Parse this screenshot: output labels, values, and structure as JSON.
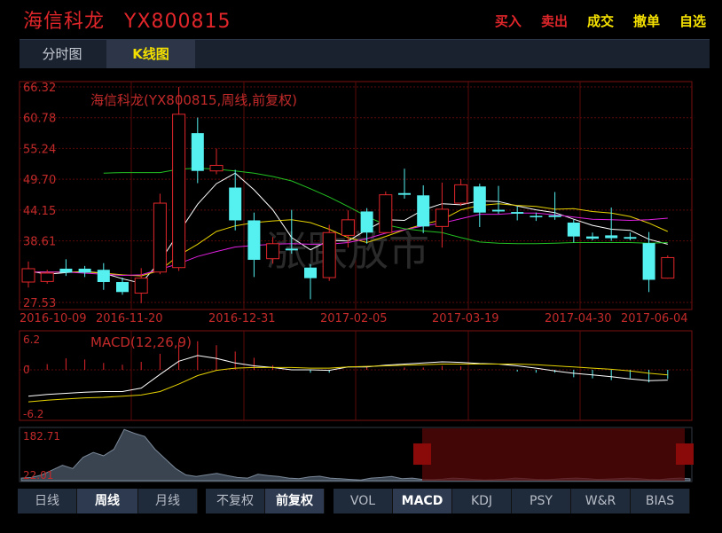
{
  "header": {
    "stock_name": "海信科龙",
    "stock_code": "YX800815",
    "actions": [
      {
        "label": "买入",
        "color": "#e0262a"
      },
      {
        "label": "卖出",
        "color": "#e0262a"
      },
      {
        "label": "成交",
        "color": "#f4e000"
      },
      {
        "label": "撤单",
        "color": "#f4e000"
      },
      {
        "label": "自选",
        "color": "#f4e000"
      }
    ]
  },
  "tabs": [
    {
      "label": "分时图",
      "active": false
    },
    {
      "label": "K线图",
      "active": true
    }
  ],
  "kline": {
    "legend": "海信科龙(YX800815,周线,前复权)",
    "y_ticks": [
      "66.32",
      "60.78",
      "55.24",
      "49.70",
      "44.15",
      "38.61",
      "27.53"
    ],
    "y_values": [
      66.32,
      60.78,
      55.24,
      49.7,
      44.15,
      38.61,
      27.53
    ],
    "x_labels": [
      "2016-10-09",
      "2016-11-20",
      "2016-12-31",
      "2017-02-05",
      "2017-03-19",
      "2017-04-30",
      "2017-06-04"
    ],
    "watermark": "涨跌放市",
    "colors": {
      "up": "#e0262a",
      "down": "#55f0f0",
      "ma1": "#ffffff",
      "ma2": "#e6d200",
      "ma3": "#e020e0",
      "ma4": "#22c022"
    }
  },
  "macd": {
    "legend": "MACD(12,26,9)",
    "y_ticks": [
      "6.2",
      "0",
      "-6.2"
    ]
  },
  "volume": {
    "y_ticks": [
      "182.71",
      "22.01"
    ]
  },
  "bottom_groups": [
    {
      "buttons": [
        {
          "label": "日线",
          "active": false
        },
        {
          "label": "周线",
          "active": true
        },
        {
          "label": "月线",
          "active": false
        }
      ]
    },
    {
      "buttons": [
        {
          "label": "不复权",
          "active": false
        },
        {
          "label": "前复权",
          "active": true
        }
      ]
    },
    {
      "buttons": [
        {
          "label": "VOL",
          "active": false
        },
        {
          "label": "MACD",
          "active": true
        },
        {
          "label": "KDJ",
          "active": false
        },
        {
          "label": "PSY",
          "active": false
        },
        {
          "label": "W&R",
          "active": false
        },
        {
          "label": "BIAS",
          "active": false
        }
      ]
    }
  ],
  "chart_data": {
    "type": "candlestick",
    "title": "海信科龙(YX800815,周线,前复权)",
    "x_ticks": [
      "2016-10-09",
      "2016-11-20",
      "2016-12-31",
      "2017-02-05",
      "2017-03-19",
      "2017-04-30",
      "2017-06-04"
    ],
    "ylim": [
      27.53,
      66.32
    ],
    "candles": [
      {
        "o": 31.2,
        "c": 33.6,
        "h": 34.9,
        "l": 30.2
      },
      {
        "o": 31.3,
        "c": 32.8,
        "h": 33.4,
        "l": 30.9
      },
      {
        "o": 33.6,
        "c": 32.9,
        "h": 35.3,
        "l": 32.3
      },
      {
        "o": 33.6,
        "c": 32.9,
        "h": 34.1,
        "l": 32.1
      },
      {
        "o": 33.4,
        "c": 31.2,
        "h": 34.6,
        "l": 29.8
      },
      {
        "o": 31.2,
        "c": 29.4,
        "h": 32.0,
        "l": 28.9
      },
      {
        "o": 29.2,
        "c": 31.9,
        "h": 33.7,
        "l": 27.4
      },
      {
        "o": 33.0,
        "c": 45.4,
        "h": 47.1,
        "l": 32.6
      },
      {
        "o": 33.8,
        "c": 61.4,
        "h": 66.3,
        "l": 33.2
      },
      {
        "o": 58.0,
        "c": 51.2,
        "h": 60.8,
        "l": 49.0
      },
      {
        "o": 51.2,
        "c": 52.2,
        "h": 55.2,
        "l": 50.6
      },
      {
        "o": 48.2,
        "c": 42.3,
        "h": 51.4,
        "l": 40.5
      },
      {
        "o": 42.3,
        "c": 35.2,
        "h": 43.7,
        "l": 32.1
      },
      {
        "o": 35.4,
        "c": 38.1,
        "h": 39.3,
        "l": 34.5
      },
      {
        "o": 37.2,
        "c": 36.9,
        "h": 44.2,
        "l": 36.3
      },
      {
        "o": 33.8,
        "c": 31.9,
        "h": 34.4,
        "l": 28.1
      },
      {
        "o": 32.0,
        "c": 40.1,
        "h": 41.5,
        "l": 31.4
      },
      {
        "o": 39.6,
        "c": 42.4,
        "h": 44.1,
        "l": 37.4
      },
      {
        "o": 43.9,
        "c": 40.1,
        "h": 44.5,
        "l": 38.1
      },
      {
        "o": 40.1,
        "c": 46.9,
        "h": 47.5,
        "l": 40.0
      },
      {
        "o": 47.2,
        "c": 46.9,
        "h": 51.6,
        "l": 46.2
      },
      {
        "o": 46.8,
        "c": 41.2,
        "h": 48.6,
        "l": 40.0
      },
      {
        "o": 41.2,
        "c": 44.3,
        "h": 49.1,
        "l": 37.4
      },
      {
        "o": 45.4,
        "c": 48.7,
        "h": 49.7,
        "l": 44.9
      },
      {
        "o": 48.4,
        "c": 43.7,
        "h": 48.9,
        "l": 41.1
      },
      {
        "o": 44.2,
        "c": 43.9,
        "h": 48.5,
        "l": 43.5
      },
      {
        "o": 43.8,
        "c": 43.5,
        "h": 44.8,
        "l": 42.3
      },
      {
        "o": 43.1,
        "c": 42.9,
        "h": 43.7,
        "l": 42.2
      },
      {
        "o": 43.2,
        "c": 42.9,
        "h": 47.4,
        "l": 42.4
      },
      {
        "o": 41.9,
        "c": 39.4,
        "h": 42.4,
        "l": 38.3
      },
      {
        "o": 39.4,
        "c": 39.0,
        "h": 40.1,
        "l": 38.7
      },
      {
        "o": 39.6,
        "c": 39.1,
        "h": 44.6,
        "l": 38.6
      },
      {
        "o": 39.3,
        "c": 39.0,
        "h": 40.1,
        "l": 38.7
      },
      {
        "o": 38.2,
        "c": 31.6,
        "h": 40.2,
        "l": 29.4
      },
      {
        "o": 31.9,
        "c": 35.6,
        "h": 36.0,
        "l": 31.8
      }
    ],
    "ma_series": [
      {
        "values": [
          33.2,
          32.6,
          32.9,
          33.1,
          32.8,
          31.8,
          31.0,
          34.9,
          40.1,
          45.2,
          48.9,
          50.8,
          47.8,
          44.2,
          39.2,
          37.0,
          38.7,
          38.6,
          40.6,
          42.4,
          42.3,
          44.2,
          45.3,
          45.1,
          45.8,
          45.7,
          44.9,
          44.2,
          43.7,
          42.5,
          41.4,
          40.7,
          40.5,
          38.9,
          38.0
        ]
      },
      {
        "values": [
          33.0,
          33.0,
          33.0,
          33.0,
          32.8,
          32.5,
          32.3,
          33.3,
          36.0,
          38.0,
          40.3,
          41.3,
          41.9,
          42.2,
          42.4,
          41.9,
          40.7,
          39.2,
          38.3,
          39.4,
          40.6,
          41.6,
          42.4,
          44.2,
          45.0,
          45.3,
          45.0,
          44.8,
          44.3,
          44.4,
          43.9,
          43.6,
          43.0,
          41.8,
          40.3
        ]
      },
      {
        "values": [
          33.0,
          33.0,
          33.0,
          32.8,
          32.6,
          32.4,
          32.5,
          33.5,
          34.5,
          35.8,
          36.7,
          37.5,
          37.8,
          38.0,
          38.1,
          38.0,
          38.0,
          38.3,
          39.0,
          40.0,
          40.6,
          41.3,
          41.8,
          42.6,
          43.4,
          43.4,
          43.6,
          43.6,
          43.3,
          42.9,
          42.5,
          42.4,
          42.3,
          42.4,
          42.7
        ]
      },
      {
        "values": [
          null,
          null,
          null,
          null,
          50.8,
          50.9,
          50.9,
          50.9,
          51.5,
          51.7,
          51.5,
          51.2,
          50.8,
          50.2,
          49.4,
          48.0,
          46.5,
          44.8,
          43.0,
          41.5,
          40.8,
          40.4,
          40.1,
          39.2,
          38.4,
          38.2,
          38.1,
          38.1,
          38.2,
          38.3,
          38.3,
          38.3,
          38.3,
          38.2,
          38.3
        ]
      }
    ],
    "macd": {
      "dif": [
        -4.6,
        -4.3,
        -4.1,
        -3.9,
        -3.8,
        -3.8,
        -3.2,
        -0.8,
        1.5,
        2.5,
        2.0,
        1.2,
        0.7,
        0.4,
        0.0,
        0.0,
        -0.1,
        0.5,
        0.5,
        0.8,
        1.0,
        1.2,
        1.4,
        1.3,
        1.1,
        1.0,
        0.7,
        0.3,
        -0.2,
        -0.6,
        -0.9,
        -1.2,
        -1.6,
        -1.9,
        -1.8
      ],
      "dea": [
        -5.6,
        -5.3,
        -5.1,
        -4.9,
        -4.8,
        -4.6,
        -4.4,
        -3.8,
        -2.5,
        -1.0,
        -0.1,
        0.3,
        0.4,
        0.4,
        0.4,
        0.3,
        0.3,
        0.5,
        0.6,
        0.7,
        0.8,
        0.9,
        1.0,
        1.0,
        1.0,
        1.0,
        1.0,
        0.9,
        0.7,
        0.5,
        0.3,
        0.1,
        -0.2,
        -0.6,
        -0.9
      ],
      "hist": [
        0.8,
        1.0,
        2.0,
        1.8,
        1.2,
        0.9,
        1.4,
        2.8,
        4.9,
        5.0,
        4.3,
        3.2,
        2.1,
        0.8,
        0.0,
        -0.5,
        -0.5,
        0.0,
        0.5,
        0.0,
        0.4,
        0.4,
        0.7,
        0.6,
        0.1,
        0.0,
        -0.3,
        -0.5,
        -0.5,
        -1.3,
        -1.5,
        -1.8,
        -1.5,
        -2.2,
        -1.6
      ]
    },
    "volume_overview": [
      30,
      32,
      40,
      55,
      70,
      60,
      95,
      110,
      100,
      120,
      182,
      170,
      160,
      120,
      90,
      60,
      40,
      35,
      40,
      45,
      38,
      32,
      30,
      42,
      38,
      35,
      30,
      28,
      34,
      36,
      30,
      28,
      26,
      24,
      30,
      32,
      35,
      28,
      30,
      26,
      25,
      27,
      30,
      28,
      26,
      24,
      25,
      27,
      30,
      28,
      26,
      25,
      27,
      29,
      30,
      28,
      26,
      27,
      28,
      30,
      28,
      26,
      25,
      28,
      30,
      28
    ]
  }
}
